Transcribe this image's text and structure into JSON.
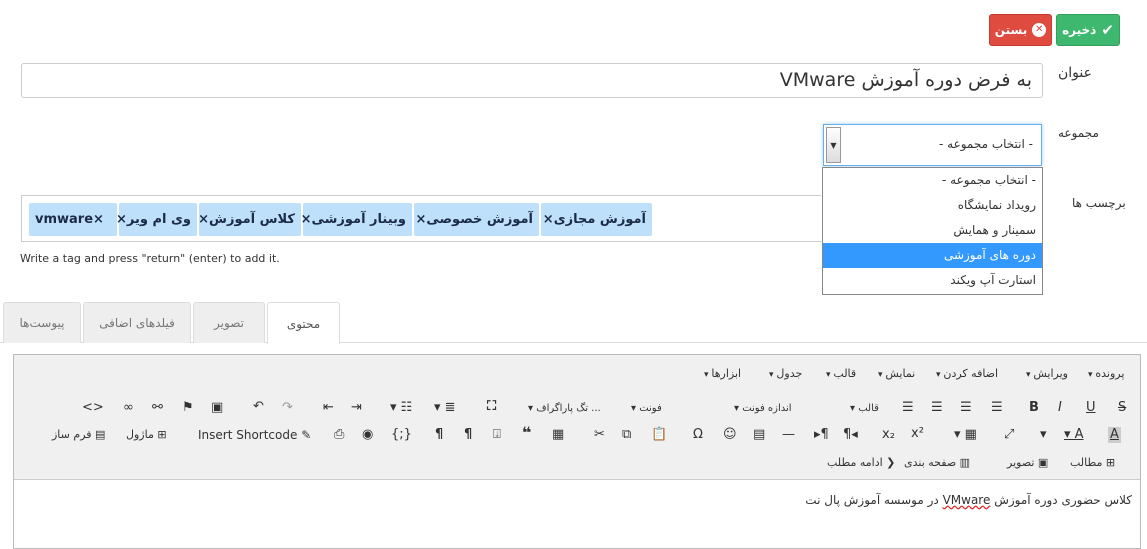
{
  "actions": {
    "save": "ذخیره",
    "close": "بستن"
  },
  "form": {
    "title_label": "عنوان",
    "title_value": "به فرض دوره آموزش VMware",
    "category_label": "مجموعه",
    "category_selected": "- انتخاب مجموعه -",
    "category_options": [
      "- انتخاب مجموعه -",
      "رویداد نمایشگاه",
      "سمینار و همایش",
      "دوره های آموزشی",
      "استارت آپ ویکند"
    ],
    "category_highlighted": 3,
    "tags_label": "برچسب ها",
    "tags": [
      "آموزش مجازی×",
      "آموزش خصوصی×",
      "وبینار آموزشی×",
      "کلاس آموزش×",
      "وی ام ویر×",
      "vmware×"
    ],
    "tags_hint": "Write a tag and press \"return\" (enter) to add it."
  },
  "tabs": [
    "محتوی",
    "تصویر",
    "فیلدهای اضافی",
    "پیوست‌ها"
  ],
  "editor": {
    "menus": [
      "پرونده",
      "ویرایش",
      "اضافه کردن",
      "نمایش",
      "قالب",
      "جدول",
      "ابزارها"
    ],
    "font_family": "فونت",
    "font_size": "اندازه فونت",
    "format": "قالب",
    "paragraph": "تگ پاراگراف ...",
    "buttons": {
      "insert_shortcode": "Insert Shortcode",
      "module": "ماژول",
      "form_builder": "فرم ساز",
      "article": "مطالب",
      "image": "تصویر",
      "pagebreak": "صفحه بندی",
      "readmore": "ادامه مطلب"
    },
    "content_before": "کلاس حضوری دوره آموزش ",
    "content_word": "VMware",
    "content_after": " در موسسه آموزش پال نت"
  },
  "colors": {
    "save": "#3fb86f",
    "close": "#e04b40",
    "tag_bg": "#bfe0fa",
    "select_highlight": "#3399ff"
  }
}
